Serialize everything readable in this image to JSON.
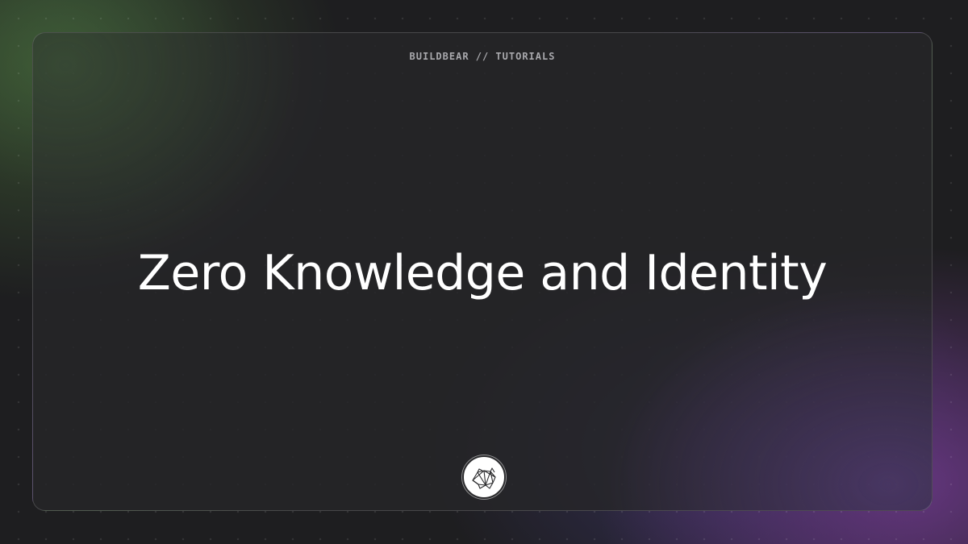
{
  "header": {
    "eyebrow": "BUILDBEAR // TUTORIALS"
  },
  "main": {
    "title": "Zero Knowledge and Identity"
  },
  "logo": {
    "icon": "bear-head-icon"
  },
  "colors": {
    "background": "#1e1e20",
    "title": "#ffffff",
    "eyebrow": "#a9a9ad",
    "accent_green": "#4e783c",
    "accent_purple": "#783c96"
  }
}
